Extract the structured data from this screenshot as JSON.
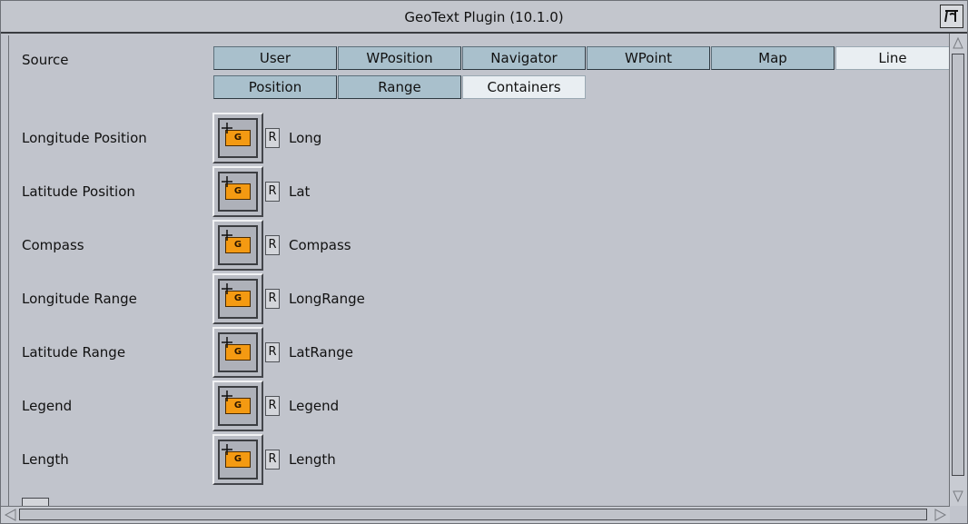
{
  "window": {
    "title": "GeoText Plugin (10.1.0)"
  },
  "source_label": "Source",
  "tabs_row1": [
    "User",
    "WPosition",
    "Navigator",
    "WPoint",
    "Map",
    "Line"
  ],
  "tabs_row2": [
    "Position",
    "Range",
    "Containers"
  ],
  "active_tabs": {
    "row1": "Line",
    "row2": "Containers"
  },
  "button_glyphs": {
    "chip": "G",
    "reset": "R"
  },
  "rows": [
    {
      "label": "Longitude Position",
      "container": "Long"
    },
    {
      "label": "Latitude Position",
      "container": "Lat"
    },
    {
      "label": "Compass",
      "container": "Compass"
    },
    {
      "label": "Longitude Range",
      "container": "LongRange"
    },
    {
      "label": "Latitude Range",
      "container": "LatRange"
    },
    {
      "label": "Legend",
      "container": "Legend"
    },
    {
      "label": "Length",
      "container": "Length"
    }
  ],
  "colors": {
    "panel": "#c1c4cc",
    "tab": "#a9c0cc",
    "tab_active": "#e9eef2",
    "chip": "#f49a12"
  },
  "icons": {
    "plugin": "plugin-pi-icon",
    "chip": "container-drop-icon",
    "reset": "reset-icon"
  }
}
